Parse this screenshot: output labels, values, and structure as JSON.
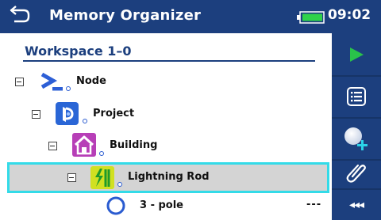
{
  "header": {
    "title": "Memory Organizer",
    "time": "09:02",
    "back_icon": "back-arrow-icon",
    "battery_icon": "battery-full-icon",
    "battery_color": "#2fd24a"
  },
  "workspace": {
    "label": "Workspace 1–0"
  },
  "tree": [
    {
      "label": "Node",
      "icon": "node-terminal-icon"
    },
    {
      "label": "Project",
      "icon": "project-icon"
    },
    {
      "label": "Building",
      "icon": "building-home-icon"
    },
    {
      "label": "Lightning Rod",
      "icon": "lightning-rod-icon",
      "selected": true
    },
    {
      "label": "3 - pole",
      "icon": "measurement-empty-circle-icon",
      "status": "---"
    }
  ],
  "sidebar": {
    "buttons": [
      {
        "name": "start-measurement",
        "icon": "play-icon"
      },
      {
        "name": "view-results",
        "icon": "list-icon"
      },
      {
        "name": "add-measurement",
        "icon": "add-circle-icon"
      },
      {
        "name": "attachments",
        "icon": "paperclip-icon"
      }
    ],
    "more_label": "◂◂◂"
  },
  "colors": {
    "header_bg": "#1c3f7e",
    "selection_border": "#33dbe8",
    "selection_bg": "#d4d4d4",
    "play_green": "#29c24a",
    "add_plus": "#2bd3e8"
  }
}
